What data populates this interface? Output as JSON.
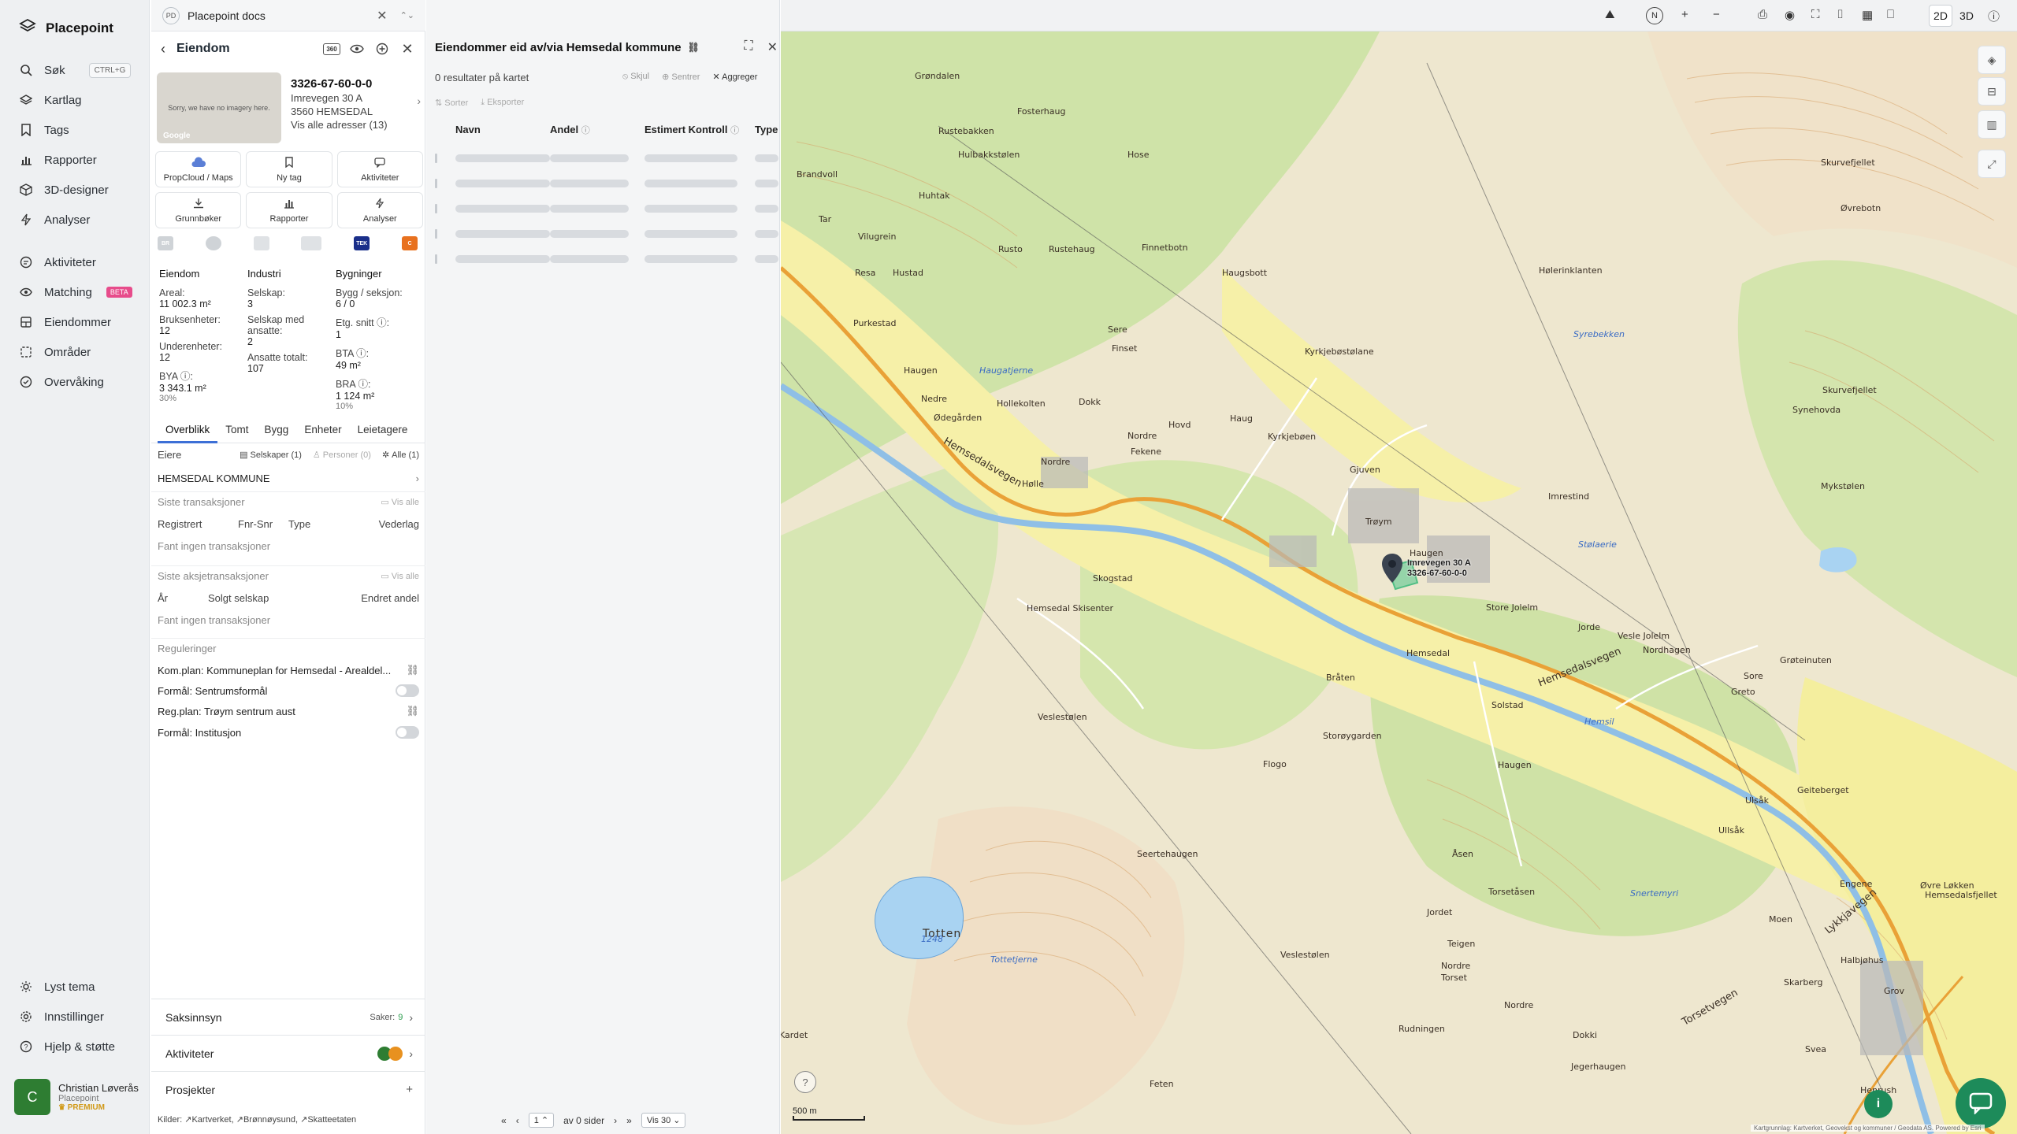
{
  "app": {
    "brand": "Placepoint",
    "docs_tab": "Placepoint docs",
    "docs_badge": "PD"
  },
  "nav": {
    "items": [
      {
        "label": "Søk",
        "icon": "search-icon",
        "shortcut": "CTRL+G"
      },
      {
        "label": "Kartlag",
        "icon": "layers-icon"
      },
      {
        "label": "Tags",
        "icon": "bookmark-icon"
      },
      {
        "label": "Rapporter",
        "icon": "bar-chart-icon"
      },
      {
        "label": "3D-designer",
        "icon": "cube-icon"
      },
      {
        "label": "Analyser",
        "icon": "bolt-icon"
      }
    ],
    "items2": [
      {
        "label": "Aktiviteter",
        "icon": "chat-icon"
      },
      {
        "label": "Matching",
        "icon": "match-icon",
        "badge": "BETA"
      },
      {
        "label": "Eiendommer",
        "icon": "building-icon"
      },
      {
        "label": "Områder",
        "icon": "area-icon"
      },
      {
        "label": "Overvåking",
        "icon": "monitor-icon"
      }
    ],
    "bottom": [
      {
        "label": "Lyst tema",
        "icon": "sun-icon"
      },
      {
        "label": "Innstillinger",
        "icon": "gear-icon"
      },
      {
        "label": "Hjelp & støtte",
        "icon": "help-icon"
      }
    ],
    "user": {
      "initial": "C",
      "name": "Christian Løverås",
      "org": "Placepoint",
      "plan": "PREMIUM"
    }
  },
  "property": {
    "header": "Eiendom",
    "badge_360": "360",
    "thumb_text": "Sorry, we have no imagery here.",
    "thumb_brand": "Google",
    "id": "3326-67-60-0-0",
    "street": "Imrevegen 30 A",
    "postal": "3560 HEMSEDAL",
    "all_addresses": "Vis alle adresser (13)",
    "actions": [
      {
        "label": "PropCloud / Maps",
        "icon": "cloud-icon"
      },
      {
        "label": "Ny tag",
        "icon": "bookmark-icon"
      },
      {
        "label": "Aktiviteter",
        "icon": "chat-icon"
      },
      {
        "label": "Grunnbøker",
        "icon": "download-icon"
      },
      {
        "label": "Rapporter",
        "icon": "bar-chart-icon"
      },
      {
        "label": "Analyser",
        "icon": "bolt-icon"
      }
    ],
    "sources": [
      "BR",
      "",
      "",
      "",
      "TEK",
      "C"
    ],
    "stats": {
      "eiendom": {
        "heading": "Eiendom",
        "areal_label": "Areal:",
        "areal_value": "11 002.3 m²",
        "bruks_label": "Bruksenheter:",
        "bruks_value": "12",
        "under_label": "Underenheter:",
        "under_value": "12",
        "bya_label": "BYA ⓘ:",
        "bya_value": "3 343.1 m²",
        "bya_pct": "30%"
      },
      "industri": {
        "heading": "Industri",
        "selskap_label": "Selskap:",
        "selskap_value": "3",
        "ansatte_label": "Selskap med ansatte:",
        "ansatte_value": "2",
        "tot_label": "Ansatte totalt:",
        "tot_value": "107"
      },
      "bygninger": {
        "heading": "Bygninger",
        "bygg_label": "Bygg / seksjon:",
        "bygg_value": "6 / 0",
        "etg_label": "Etg. snitt ⓘ:",
        "etg_value": "1",
        "bta_label": "BTA ⓘ:",
        "bta_value": "49 m²",
        "bra_label": "BRA ⓘ:",
        "bra_value": "1 124 m²",
        "bra_pct": "10%"
      }
    },
    "tabs": [
      "Overblikk",
      "Tomt",
      "Bygg",
      "Enheter",
      "Leietagere"
    ],
    "owners": {
      "label": "Eiere",
      "chip_companies": "Selskaper (1)",
      "chip_persons": "Personer (0)",
      "chip_all": "Alle (1)",
      "owner": "HEMSEDAL KOMMUNE"
    },
    "transactions": {
      "label": "Siste transaksjoner",
      "show_all": "Vis alle",
      "cols": [
        "Registrert",
        "Fnr-Snr",
        "Type",
        "Vederlag"
      ],
      "empty": "Fant ingen transaksjoner"
    },
    "share_tx": {
      "label": "Siste aksjetransaksjoner",
      "show_all": "Vis alle",
      "cols": [
        "År",
        "Solgt selskap",
        "Endret andel"
      ],
      "empty": "Fant ingen transaksjoner"
    },
    "regulations": {
      "label": "Reguleringer",
      "items": [
        {
          "text": "Kom.plan: Kommuneplan for Hemsedal - Arealdel...",
          "control": "link"
        },
        {
          "text": "Formål: Sentrumsformål",
          "control": "toggle"
        },
        {
          "text": "Reg.plan: Trøym sentrum aust",
          "control": "link"
        },
        {
          "text": "Formål: Institusjon",
          "control": "toggle"
        }
      ]
    },
    "accordion": {
      "saksinnsyn": "Saksinnsyn",
      "saker_label": "Saker:",
      "saker_count": "9",
      "aktiviteter": "Aktiviteter",
      "prosjekter": "Prosjekter"
    },
    "sources_footer": {
      "label": "Kilder:",
      "items": [
        "Kartverket,",
        "Brønnøysund,",
        "Skatteetaten"
      ]
    }
  },
  "results": {
    "title": "Eiendommer eid av/via Hemsedal kommune",
    "count": "0 resultater på kartet",
    "hide": "Skjul",
    "center": "Sentrer",
    "aggregate": "Aggreger",
    "sort": "Sorter",
    "export": "Eksporter",
    "columns": [
      "Navn",
      "Andel",
      "Estimert Kontroll",
      "Type"
    ],
    "skeleton_rows": 5,
    "pager": {
      "of_pages": "av 0 sider",
      "page": "1",
      "per_page": "Vis 30"
    }
  },
  "map": {
    "toolbar": {
      "mode_2d": "2D",
      "mode_3d": "3D",
      "north": "N"
    },
    "pin_label_1": "Imrevegen 30 A",
    "pin_label_2": "3326-67-60-0-0",
    "scale": "500 m",
    "attribution": "Kartgrunnlag: Kartverket, Geovekst og kommuner / Geodata AS. Powered by Esri",
    "places": [
      {
        "t": "Grøndalen"
      },
      {
        "t": "Rustebakken"
      },
      {
        "t": "Fosterhaug"
      },
      {
        "t": "Hulbakkstølen"
      },
      {
        "t": "Brandvoll"
      },
      {
        "t": "Huhtak"
      },
      {
        "t": "Hose"
      },
      {
        "t": "Skurvefjellet"
      },
      {
        "t": "Øvrebotn"
      },
      {
        "t": "Tar"
      },
      {
        "t": "Vilugrein"
      },
      {
        "t": "Rusto"
      },
      {
        "t": "Rustehaug"
      },
      {
        "t": "Finnetbotn"
      },
      {
        "t": "Resa"
      },
      {
        "t": "Hustad"
      },
      {
        "t": "Haugsbott"
      },
      {
        "t": "Hølerinklanten"
      },
      {
        "t": "Purkestad"
      },
      {
        "t": "Sere"
      },
      {
        "t": "Finset"
      },
      {
        "t": "Kyrkjebøstølane"
      },
      {
        "t": "Haugen"
      },
      {
        "t": "Nedre"
      },
      {
        "t": "Ødegården"
      },
      {
        "t": "Hollekolten"
      },
      {
        "t": "Dokk"
      },
      {
        "t": "Hovd"
      },
      {
        "t": "Haug"
      },
      {
        "t": "Skurvefjellet"
      },
      {
        "t": "Synehovda"
      },
      {
        "t": "Nordre"
      },
      {
        "t": "Fekene"
      },
      {
        "t": "Kyrkjebøen"
      },
      {
        "t": "Gjuven"
      },
      {
        "t": "Nordre"
      },
      {
        "t": "Hølle"
      },
      {
        "t": "Mykstølen"
      },
      {
        "t": "Trøym"
      },
      {
        "t": "Imrestind"
      },
      {
        "t": "Haugen"
      },
      {
        "t": "Hemsedal Skisenter"
      },
      {
        "t": "Skogstad"
      },
      {
        "t": "Store Jolelm"
      },
      {
        "t": "Jorde"
      },
      {
        "t": "Vesle Jolelm"
      },
      {
        "t": "Nordhagen"
      },
      {
        "t": "Grøteinuten"
      },
      {
        "t": "Hemsedal"
      },
      {
        "t": "Bråten"
      },
      {
        "t": "Sore"
      },
      {
        "t": "Greto"
      },
      {
        "t": "Solstad"
      },
      {
        "t": "Veslestølen"
      },
      {
        "t": "Storøygarden"
      },
      {
        "t": "Flogo"
      },
      {
        "t": "Haugen"
      },
      {
        "t": "Geiteberget"
      },
      {
        "t": "Ulsåk"
      },
      {
        "t": "Ullsåk"
      },
      {
        "t": "Seertehaugen"
      },
      {
        "t": "Åsen"
      },
      {
        "t": "Torsetåsen"
      },
      {
        "t": "Engene"
      },
      {
        "t": "Øvre Løkken"
      },
      {
        "t": "Hemsedalsfjellet"
      },
      {
        "t": "Jordet"
      },
      {
        "t": "Moen"
      },
      {
        "t": "Totten"
      },
      {
        "t": "Veslestølen"
      },
      {
        "t": "Teigen"
      },
      {
        "t": "Nordre"
      },
      {
        "t": "Torset"
      },
      {
        "t": "Halbjøhus"
      },
      {
        "t": "Skarberg"
      },
      {
        "t": "Grov"
      },
      {
        "t": "Rudningen"
      },
      {
        "t": "Nordre"
      },
      {
        "t": "Dokki"
      },
      {
        "t": "Svea"
      },
      {
        "t": "Jegerhaugen"
      },
      {
        "t": "Feten"
      },
      {
        "t": "Henrush"
      },
      {
        "t": "Kardet"
      }
    ],
    "waters": [
      {
        "t": "Haugatjerne"
      },
      {
        "t": "Syrebekken"
      },
      {
        "t": "Stølaerie"
      },
      {
        "t": "Snertemyri"
      },
      {
        "t": "Tottetjerne"
      },
      {
        "t": "Hemsil"
      },
      {
        "t": "1248"
      }
    ],
    "roads": [
      {
        "t": "Hemsedalsvegen"
      },
      {
        "t": "Hemsedalsvegen"
      },
      {
        "t": "Lykkjavegen"
      },
      {
        "t": "Torsetvegen"
      }
    ]
  }
}
